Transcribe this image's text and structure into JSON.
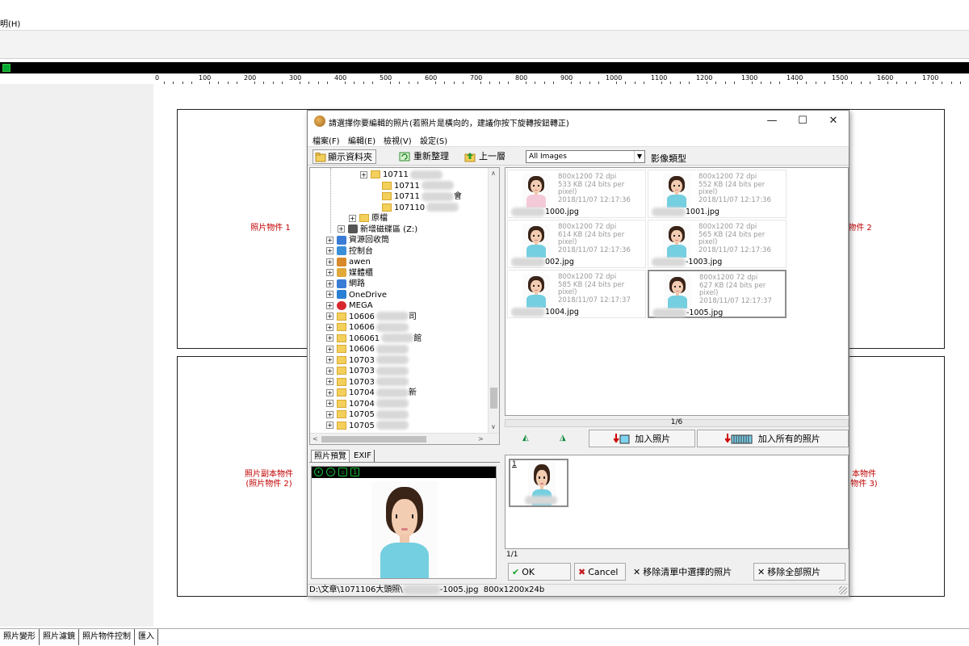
{
  "app": {
    "menu": [
      "明(H)"
    ],
    "ruler_labels": [
      "0",
      "100",
      "200",
      "300",
      "400",
      "500",
      "600",
      "700",
      "800",
      "900",
      "1000",
      "1100",
      "1200",
      "1300",
      "1400",
      "1500",
      "1600",
      "1700"
    ],
    "frames": {
      "photo1": "照片物件 1",
      "photo2_right": "物件 2",
      "copy_left": "照片副本物件\n(照片物件 2)",
      "copy_right": "本物件\n物件 3)"
    },
    "bottom_tabs": [
      "照片變形",
      "照片濾鏡",
      "照片物件控制",
      "匯入"
    ]
  },
  "dialog": {
    "title": "請選擇你要編輯的照片(若照片是橫向的，建議你按下旋轉按鈕轉正)",
    "window_buttons": {
      "minimize": "—",
      "maximize": "☐",
      "close": "✕"
    },
    "menu": [
      "檔案(F)",
      "編輯(E)",
      "檢視(V)",
      "設定(S)"
    ],
    "toolbar": {
      "show_folders": "顯示資料夾",
      "refresh": "重新整理",
      "up_level": "上一層",
      "filter_value": "All Images",
      "image_type_label": "影像類型"
    },
    "tree": [
      {
        "indent": 3,
        "expander": "⊞",
        "label": "10711",
        "folder": true
      },
      {
        "indent": 4,
        "expander": "",
        "label": "10711",
        "folder": true
      },
      {
        "indent": 4,
        "expander": "",
        "label": "10711",
        "folder": true,
        "suffix": "會"
      },
      {
        "indent": 4,
        "expander": "",
        "label": "107110",
        "folder": true
      },
      {
        "indent": 2,
        "expander": "⊞",
        "label": "原檔",
        "folder": true
      },
      {
        "indent": 1,
        "expander": "⊞",
        "label": "新增磁碟區 (Z:)",
        "icon": "drive"
      },
      {
        "indent": 0,
        "expander": "⊞",
        "label": "資源回收筒",
        "icon": "recycle"
      },
      {
        "indent": 0,
        "expander": "⊞",
        "label": "控制台",
        "icon": "control"
      },
      {
        "indent": 0,
        "expander": "⊞",
        "label": "awen",
        "icon": "user"
      },
      {
        "indent": 0,
        "expander": "⊞",
        "label": "媒體櫃",
        "icon": "library"
      },
      {
        "indent": 0,
        "expander": "⊞",
        "label": "網路",
        "icon": "network"
      },
      {
        "indent": 0,
        "expander": "⊞",
        "label": "OneDrive",
        "icon": "cloud"
      },
      {
        "indent": 0,
        "expander": "⊞",
        "label": "MEGA",
        "icon": "mega"
      },
      {
        "indent": 0,
        "expander": "⊞",
        "label": "10606",
        "folder": true,
        "suffix": "司"
      },
      {
        "indent": 0,
        "expander": "⊞",
        "label": "10606",
        "folder": true
      },
      {
        "indent": 0,
        "expander": "⊞",
        "label": "106061",
        "folder": true,
        "suffix": "館"
      },
      {
        "indent": 0,
        "expander": "⊞",
        "label": "10606",
        "folder": true
      },
      {
        "indent": 0,
        "expander": "⊞",
        "label": "10703",
        "folder": true
      },
      {
        "indent": 0,
        "expander": "⊞",
        "label": "10703",
        "folder": true
      },
      {
        "indent": 0,
        "expander": "⊞",
        "label": "10703",
        "folder": true
      },
      {
        "indent": 0,
        "expander": "⊞",
        "label": "10704",
        "folder": true,
        "suffix": "新"
      },
      {
        "indent": 0,
        "expander": "⊞",
        "label": "10704",
        "folder": true
      },
      {
        "indent": 0,
        "expander": "⊞",
        "label": "10705",
        "folder": true
      },
      {
        "indent": 0,
        "expander": "⊞",
        "label": "10705",
        "folder": true
      }
    ],
    "preview_tabs": [
      "照片預覽",
      "EXIF"
    ],
    "thumbnails": [
      {
        "meta": [
          "800x1200 72 dpi",
          "533 KB (24 bits per pixel)",
          "2018/11/07 12:17:36"
        ],
        "fname": "1000.jpg",
        "shirt": "pink",
        "selected": false
      },
      {
        "meta": [
          "800x1200 72 dpi",
          "552 KB (24 bits per pixel)",
          "2018/11/07 12:17:36"
        ],
        "fname": "1001.jpg",
        "shirt": "blue",
        "selected": false
      },
      {
        "meta": [
          "800x1200 72 dpi",
          "614 KB (24 bits per pixel)",
          "2018/11/07 12:17:36"
        ],
        "fname": "002.jpg",
        "shirt": "blue",
        "selected": false
      },
      {
        "meta": [
          "800x1200 72 dpi",
          "565 KB (24 bits per pixel)",
          "2018/11/07 12:17:36"
        ],
        "fname": "-1003.jpg",
        "shirt": "blue",
        "selected": false
      },
      {
        "meta": [
          "800x1200 72 dpi",
          "585 KB (24 bits per pixel)",
          "2018/11/07 12:17:37"
        ],
        "fname": "1004.jpg",
        "shirt": "blue",
        "selected": false
      },
      {
        "meta": [
          "800x1200 72 dpi",
          "627 KB (24 bits per pixel)",
          "2018/11/07 12:17:37"
        ],
        "fname": "-1005.jpg",
        "shirt": "blue",
        "selected": true
      }
    ],
    "page_indicator": "1/6",
    "add_photo": "加入照片",
    "add_all": "加入所有的照片",
    "selected_thumb_number": "1",
    "selected_count": "1/1",
    "ok": "OK",
    "cancel": "Cancel",
    "remove_selected": "移除清單中選擇的照片",
    "remove_all": "移除全部照片",
    "status_path": "D:\\文章\\1071106大頭照\\",
    "status_file": "-1005.jpg",
    "status_size": "800x1200x24b"
  },
  "colors": {
    "frame_label": "#c00000",
    "shirt_blue": "#74cfe0",
    "shirt_pink": "#f4c9d8",
    "folder": "#f3cf5b"
  }
}
